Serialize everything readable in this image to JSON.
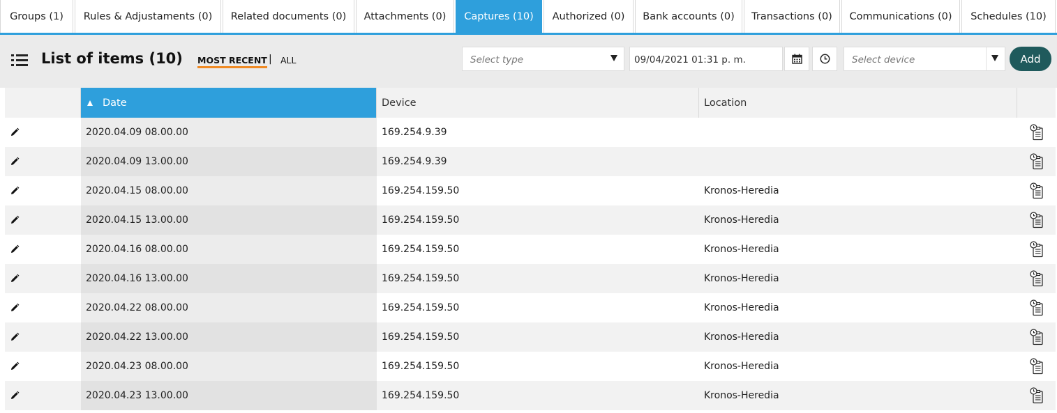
{
  "tabs": [
    {
      "label": "Groups (1)",
      "active": false
    },
    {
      "label": "Rules & Adjustaments (0)",
      "active": false
    },
    {
      "label": "Related documents (0)",
      "active": false
    },
    {
      "label": "Attachments (0)",
      "active": false
    },
    {
      "label": "Captures (10)",
      "active": true
    },
    {
      "label": "Authorized (0)",
      "active": false
    },
    {
      "label": "Bank accounts (0)",
      "active": false
    },
    {
      "label": "Transactions (0)",
      "active": false
    },
    {
      "label": "Communications (0)",
      "active": false
    },
    {
      "label": "Schedules (10)",
      "active": false
    }
  ],
  "toolbar": {
    "title": "List of items (10)",
    "filter_recent": "MOST RECENT",
    "filter_separator": "|",
    "filter_all": "ALL",
    "type_placeholder": "Select type",
    "date_value": "09/04/2021 01:31 p. m.",
    "device_placeholder": "Select device",
    "add_label": "Add"
  },
  "table": {
    "columns": {
      "date": "Date",
      "device": "Device",
      "location": "Location"
    },
    "sort": "date-ascending",
    "rows": [
      {
        "date": "2020.04.09 08.00.00",
        "device": "169.254.9.39",
        "location": ""
      },
      {
        "date": "2020.04.09 13.00.00",
        "device": "169.254.9.39",
        "location": ""
      },
      {
        "date": "2020.04.15 08.00.00",
        "device": "169.254.159.50",
        "location": "Kronos-Heredia"
      },
      {
        "date": "2020.04.15 13.00.00",
        "device": "169.254.159.50",
        "location": "Kronos-Heredia"
      },
      {
        "date": "2020.04.16 08.00.00",
        "device": "169.254.159.50",
        "location": "Kronos-Heredia"
      },
      {
        "date": "2020.04.16 13.00.00",
        "device": "169.254.159.50",
        "location": "Kronos-Heredia"
      },
      {
        "date": "2020.04.22 08.00.00",
        "device": "169.254.159.50",
        "location": "Kronos-Heredia"
      },
      {
        "date": "2020.04.22 13.00.00",
        "device": "169.254.159.50",
        "location": "Kronos-Heredia"
      },
      {
        "date": "2020.04.23 08.00.00",
        "device": "169.254.159.50",
        "location": "Kronos-Heredia"
      },
      {
        "date": "2020.04.23 13.00.00",
        "device": "169.254.159.50",
        "location": "Kronos-Heredia"
      }
    ]
  },
  "icons": {
    "list": "list-icon",
    "calendar": "calendar-icon",
    "clock": "clock-icon",
    "edit": "pencil-icon",
    "row_action": "clipboard-clock-icon",
    "dropdown": "caret-down-icon",
    "sort": "sort-ascending-icon"
  },
  "colors": {
    "accent": "#2e9fdc",
    "active_filter_underline": "#f08a24",
    "add_button": "#1f5a5c",
    "toolbar_bg": "#ebebeb"
  }
}
